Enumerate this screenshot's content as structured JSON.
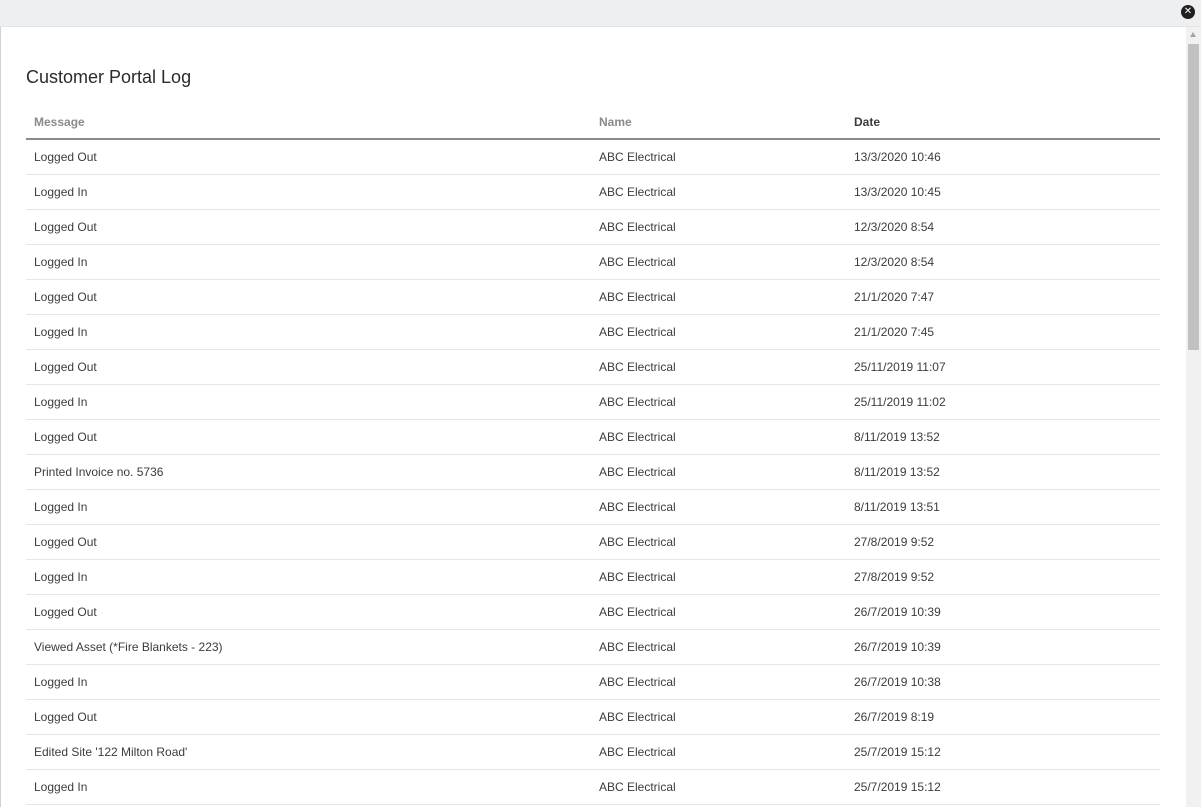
{
  "title": "Customer Portal Log",
  "close_label": "✕",
  "columns": {
    "message": "Message",
    "name": "Name",
    "date": "Date"
  },
  "rows": [
    {
      "message": "Logged Out",
      "name": "ABC Electrical",
      "date": "13/3/2020 10:46"
    },
    {
      "message": "Logged In",
      "name": "ABC Electrical",
      "date": "13/3/2020 10:45"
    },
    {
      "message": "Logged Out",
      "name": "ABC Electrical",
      "date": "12/3/2020 8:54"
    },
    {
      "message": "Logged In",
      "name": "ABC Electrical",
      "date": "12/3/2020 8:54"
    },
    {
      "message": "Logged Out",
      "name": "ABC Electrical",
      "date": "21/1/2020 7:47"
    },
    {
      "message": "Logged In",
      "name": "ABC Electrical",
      "date": "21/1/2020 7:45"
    },
    {
      "message": "Logged Out",
      "name": "ABC Electrical",
      "date": "25/11/2019 11:07"
    },
    {
      "message": "Logged In",
      "name": "ABC Electrical",
      "date": "25/11/2019 11:02"
    },
    {
      "message": "Logged Out",
      "name": "ABC Electrical",
      "date": "8/11/2019 13:52"
    },
    {
      "message": "Printed Invoice no. 5736",
      "name": "ABC Electrical",
      "date": "8/11/2019 13:52"
    },
    {
      "message": "Logged In",
      "name": "ABC Electrical",
      "date": "8/11/2019 13:51"
    },
    {
      "message": "Logged Out",
      "name": "ABC Electrical",
      "date": "27/8/2019 9:52"
    },
    {
      "message": "Logged In",
      "name": "ABC Electrical",
      "date": "27/8/2019 9:52"
    },
    {
      "message": "Logged Out",
      "name": "ABC Electrical",
      "date": "26/7/2019 10:39"
    },
    {
      "message": "Viewed Asset (*Fire Blankets - 223)",
      "name": "ABC Electrical",
      "date": "26/7/2019 10:39"
    },
    {
      "message": "Logged In",
      "name": "ABC Electrical",
      "date": "26/7/2019 10:38"
    },
    {
      "message": "Logged Out",
      "name": "ABC Electrical",
      "date": "26/7/2019 8:19"
    },
    {
      "message": "Edited Site '122 Milton Road'",
      "name": "ABC Electrical",
      "date": "25/7/2019 15:12"
    },
    {
      "message": "Logged In",
      "name": "ABC Electrical",
      "date": "25/7/2019 15:12"
    }
  ]
}
